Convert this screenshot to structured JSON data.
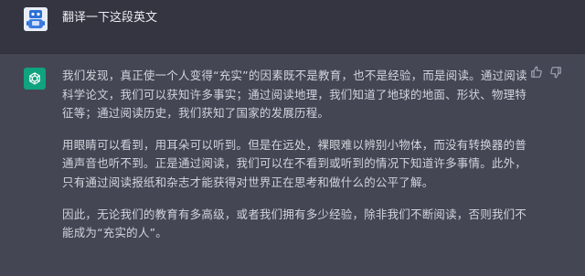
{
  "user_message": {
    "text": "翻译一下这段英文"
  },
  "assistant_message": {
    "paragraphs": [
      [
        "我们发现，真正使一个人变得“充实”的因素既不是教育，也不是经验，而是阅读。通过阅读",
        "科学论文，我们可以获知许多事实；通过阅读地理，我们知道了地球的地面、形状、物理特",
        "征等；通过阅读历史，我们获知了国家的发展历程。"
      ],
      [
        "用眼睛可以看到，用耳朵可以听到。但是在远处，裸眼难以辨别小物体，而没有转换器的普",
        "通声音也听不到。正是通过阅读，我们可以在不看到或听到的情况下知道许多事情。此外，",
        "只有通过阅读报纸和杂志才能获得对世界正在思考和做什么的公平了解。"
      ],
      [
        "因此，无论我们的教育有多高级，或者我们拥有多少经验，除非我们不断阅读，否则我们不",
        "能成为“充实的人”。"
      ]
    ]
  },
  "icons": {
    "user_avatar": "robot-avatar-icon",
    "assistant_avatar": "openai-logo-icon",
    "like": "thumbs-up-icon",
    "dislike": "thumbs-down-icon"
  },
  "colors": {
    "user_bg": "#343541",
    "assistant_bg": "#444654",
    "assistant_avatar_bg": "#10a37f",
    "text": "#d1d5db"
  }
}
